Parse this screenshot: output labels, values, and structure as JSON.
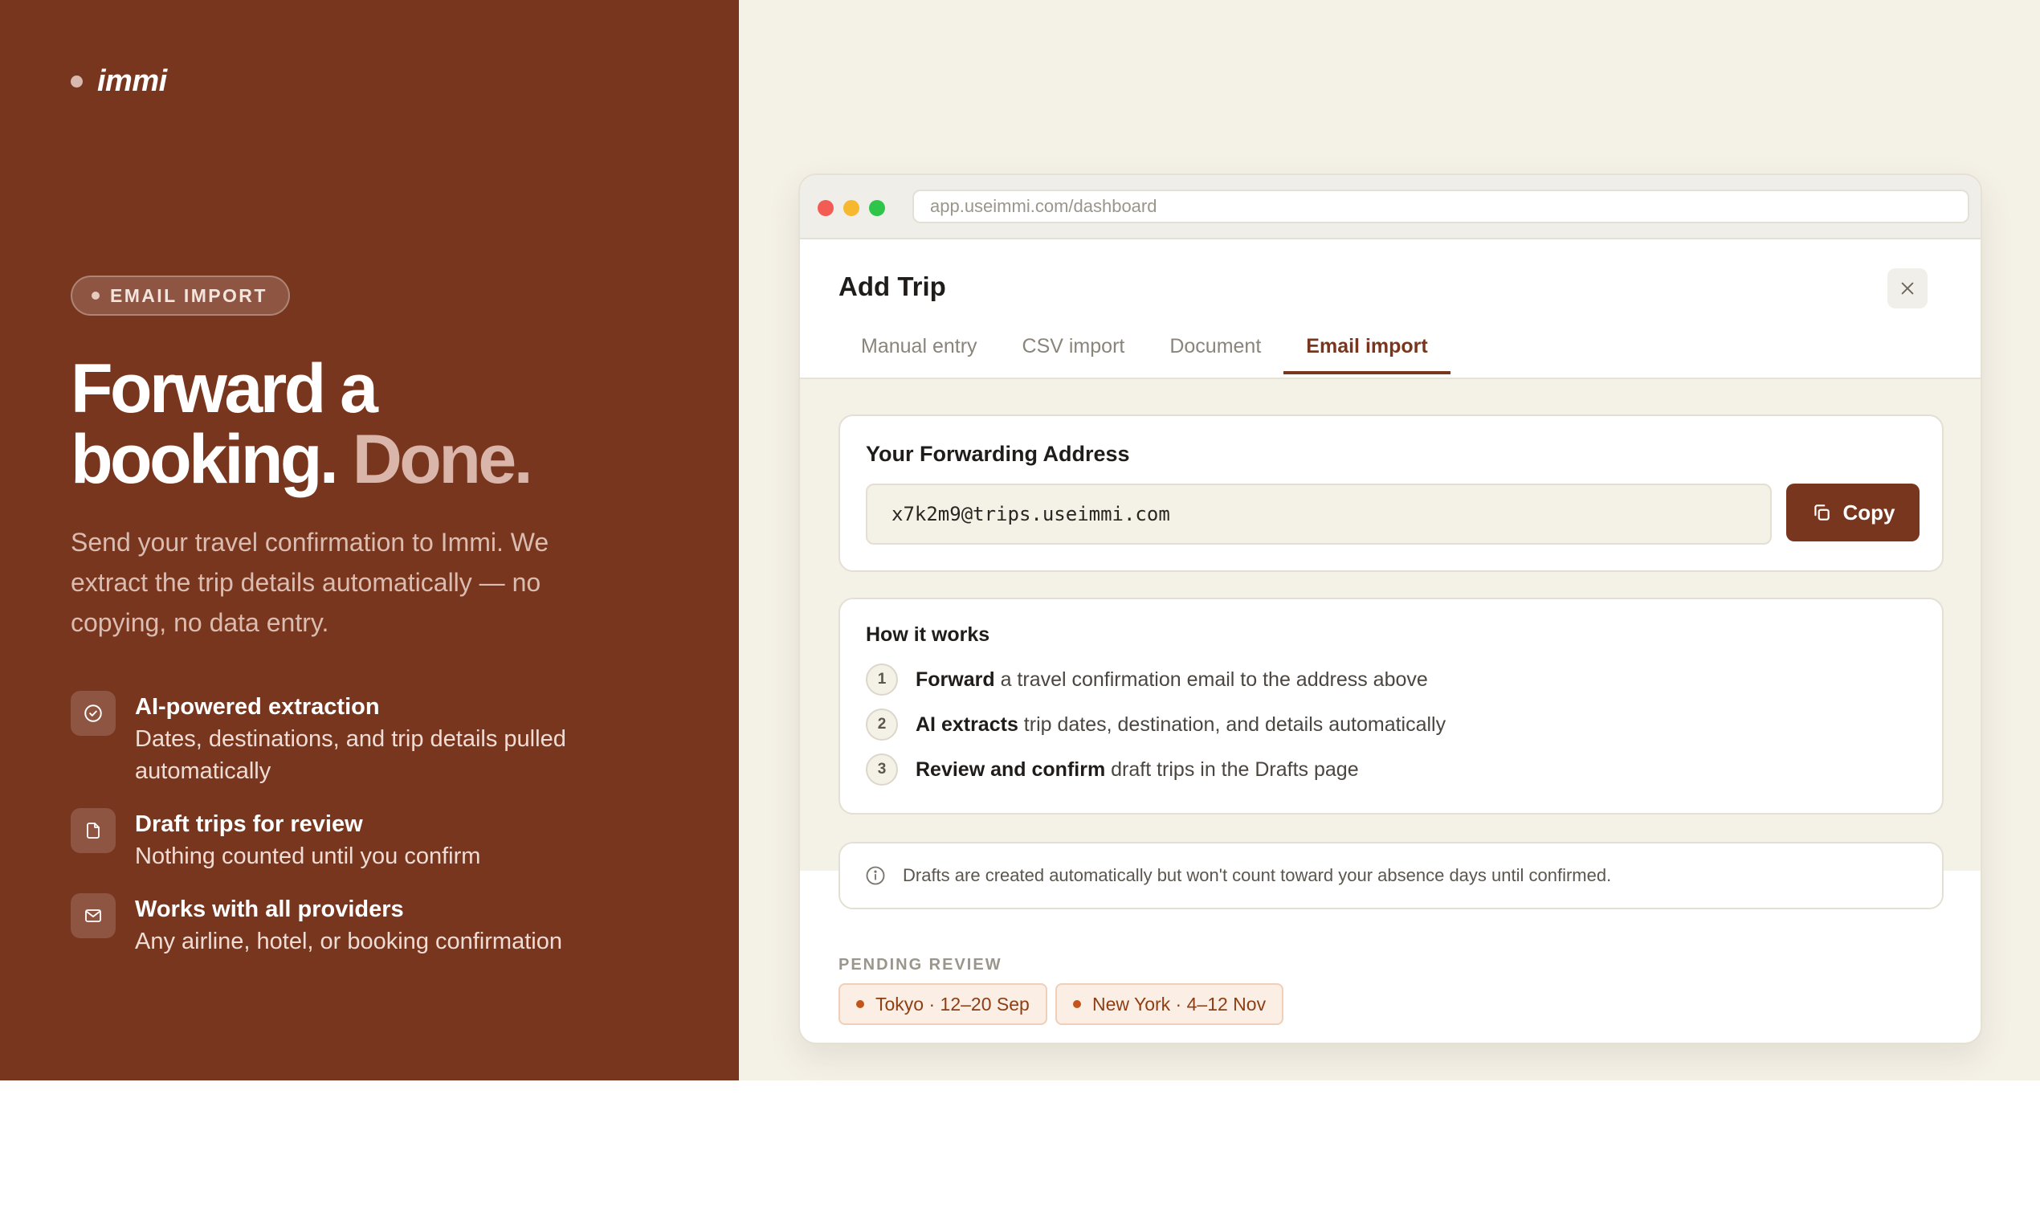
{
  "brand": {
    "name": "immi"
  },
  "hero": {
    "pill": "EMAIL IMPORT",
    "headline_line1": "Forward a",
    "headline_line2": "booking.",
    "headline_accent": "Done.",
    "subtitle": "Send your travel confirmation to Immi. We extract the trip details automatically — no copying, no data entry."
  },
  "features": [
    {
      "icon": "check-circle-icon",
      "title": "AI-powered extraction",
      "desc": "Dates, destinations, and trip details pulled automatically"
    },
    {
      "icon": "document-icon",
      "title": "Draft trips for review",
      "desc": "Nothing counted until you confirm"
    },
    {
      "icon": "mail-icon",
      "title": "Works with all providers",
      "desc": "Any airline, hotel, or booking confirmation"
    }
  ],
  "browser": {
    "url": "app.useimmi.com/dashboard"
  },
  "modal": {
    "title": "Add Trip",
    "tabs": [
      {
        "label": "Manual entry",
        "active": false
      },
      {
        "label": "CSV import",
        "active": false
      },
      {
        "label": "Document",
        "active": false
      },
      {
        "label": "Email import",
        "active": true
      }
    ],
    "forwarding": {
      "title": "Your Forwarding Address",
      "address": "x7k2m9@trips.useimmi.com",
      "copy_label": "Copy"
    },
    "how": {
      "title": "How it works",
      "steps": [
        {
          "num": "1",
          "bold": "Forward",
          "rest": " a travel confirmation email to the address above"
        },
        {
          "num": "2",
          "bold": "AI extracts",
          "rest": " trip dates, destination, and details automatically"
        },
        {
          "num": "3",
          "bold": "Review and confirm",
          "rest": " draft trips in the Drafts page"
        }
      ]
    },
    "note": "Drafts are created automatically but won't count toward your absence days until confirmed.",
    "pending": {
      "label": "PENDING REVIEW",
      "chips": [
        "Tokyo · 12–20 Sep",
        "New York · 4–12 Nov"
      ]
    }
  },
  "colors": {
    "brand": "#79361e",
    "canvas": "#f4f1e7",
    "chip": "#c2541c"
  }
}
